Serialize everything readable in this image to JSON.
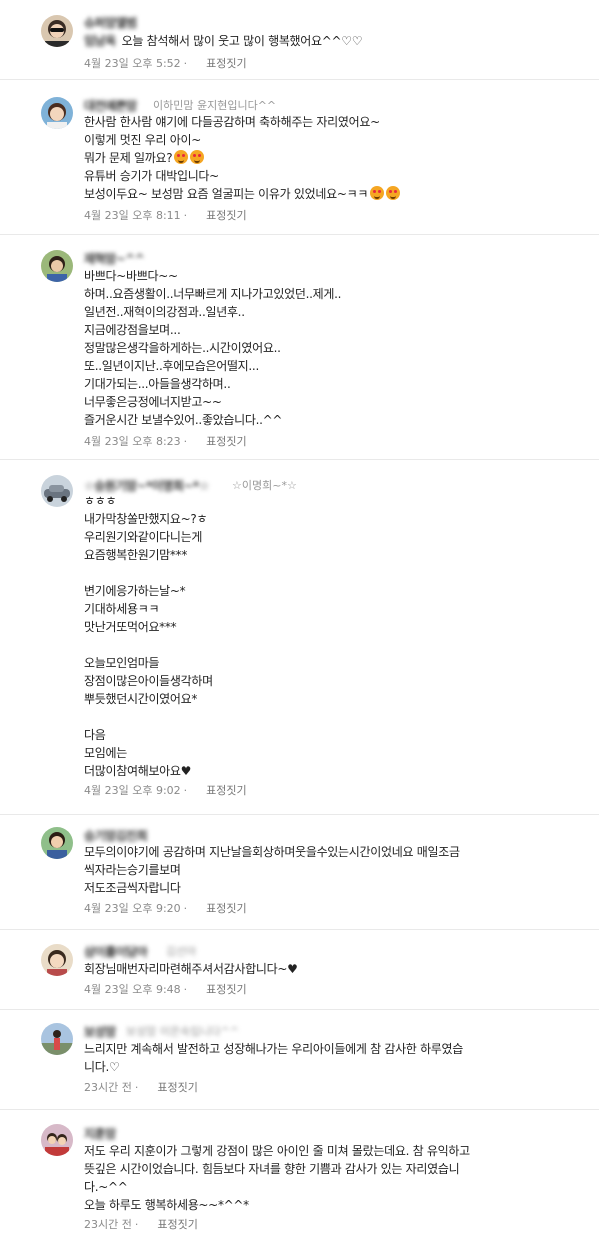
{
  "comments": [
    {
      "nickname": "슈퍼맘앨범",
      "inline_name": "임남옥",
      "lines": [
        "오늘 참석해서 많이 웃고 많이 행복했어요^^♡♡"
      ],
      "time": "4월 23일 오후 5:52",
      "react_label": "표정짓기",
      "avatar_icon": "user-avatar-icon"
    },
    {
      "nickname": "대전예쁜맘",
      "nickname_sub": "이하민맘 윤지현입니다^^",
      "lines": [
        "한사람 한사람 얘기에 다들공감하며 축하해주는 자리였어요~",
        "이렇게 멋진 우리 아이~",
        "뭐가 문제 일까요?",
        "유튜버 승기가 대박입니다~",
        "보성이두요~ 보성맘 요즘 얼굴피는 이유가 있었네요~ㅋㅋ"
      ],
      "time": "4월 23일 오후 8:11",
      "react_label": "표정짓기",
      "avatar_icon": "user-avatar-icon"
    },
    {
      "nickname": "재혁맘~^^",
      "lines": [
        "바쁘다~바쁘다~~",
        "하며..요즘생활이..너무빠르게 지나가고있었던..제게..",
        "일년전..재혁이의강점과..일년후..",
        "지금에강점을보며...",
        "정말많은생각을하게하는..시간이였어요..",
        "또..일년이지난..후에모습은어떨지...",
        "기대가되는...아들을생각하며..",
        "너무좋은긍정에너지받고~~",
        "즐거운시간 보낼수있어..좋았습니다..^^"
      ],
      "time": "4월 23일 오후 8:23",
      "react_label": "표정짓기",
      "avatar_icon": "user-avatar-icon"
    },
    {
      "nickname": "☆승원기맘~*이명희~*☆",
      "nickname_sub": "☆이명희~*☆",
      "lines": [
        "ㅎㅎㅎ",
        "내가막창쏠만했지요~?ㅎ",
        "우리원기와같이다니는게",
        "요즘행복한원기맘***",
        "",
        "변기에응가하는날~*",
        "기대하세용ㅋㅋ",
        "맛난거또먹어요***",
        "",
        "오늘모인엄마들",
        "장점이많은아이들생각하며",
        "뿌듯했던시간이였어요*",
        "",
        "다음",
        "모임에는",
        "더많이참여해보아요♥"
      ],
      "time": "4월 23일 오후 9:02",
      "react_label": "표정짓기",
      "avatar_icon": "user-avatar-icon"
    },
    {
      "nickname": "승기맘김진희",
      "lines": [
        "모두의이야기에 공감하며 지난날을회상하며웃을수있는시간이었네요 매일조금",
        "씩자라는승기를보며",
        "저도조금씩자랍니다"
      ],
      "time": "4월 23일 오후 9:20",
      "react_label": "표정짓기",
      "avatar_icon": "user-avatar-icon"
    },
    {
      "nickname": "삼이를이담아",
      "nickname_sub": "김선아",
      "lines": [
        "회장님매번자리마련해주셔서감사합니다~♥"
      ],
      "time": "4월 23일 오후 9:48",
      "react_label": "표정짓기",
      "avatar_icon": "user-avatar-icon"
    },
    {
      "nickname": "보성맘",
      "nickname_sub": "보성맘 이은숙입니다^^",
      "lines": [
        "느리지만 계속해서 발전하고 성장해나가는 우리아이들에게 참 감사한 하루였습",
        "니다.♡"
      ],
      "time": "23시간 전",
      "react_label": "표정짓기",
      "avatar_icon": "user-avatar-icon"
    },
    {
      "nickname": "지훈맘",
      "lines": [
        "저도 우리 지훈이가 그렇게 강점이 많은 아이인 줄 미쳐 몰랐는데요. 참 유익하고",
        "뜻깊은 시간이었습니다. 힘듬보다 자녀를 향한 기쁨과 감사가 있는 자리였습니",
        "다.~^^",
        "오늘 하루도 행복하세용~~*^^*"
      ],
      "time": "23시간 전",
      "react_label": "표정짓기",
      "avatar_icon": "user-avatar-icon"
    }
  ]
}
